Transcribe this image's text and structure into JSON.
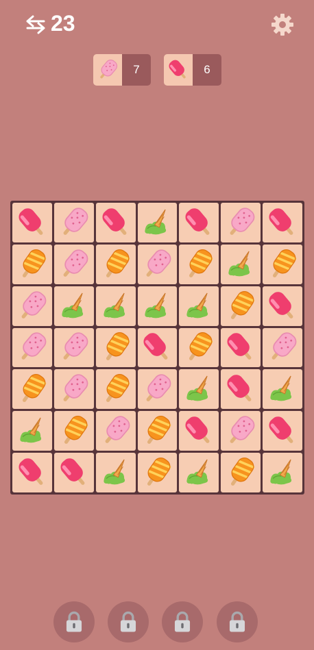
{
  "header": {
    "moves_left": "23",
    "moves_icon": "swap-arrows-icon",
    "settings_icon": "gear-icon"
  },
  "goals": [
    {
      "item": "pink-sprinkle-popsicle",
      "count": "7"
    },
    {
      "item": "red-popsicle",
      "count": "6"
    }
  ],
  "board": {
    "rows": 7,
    "cols": 7,
    "tiles": [
      [
        "red",
        "pink",
        "red",
        "cone",
        "red",
        "pink",
        "red"
      ],
      [
        "orange",
        "pink",
        "orange",
        "pink",
        "orange",
        "cone",
        "orange"
      ],
      [
        "pink",
        "cone",
        "cone",
        "cone",
        "cone",
        "orange",
        "red"
      ],
      [
        "pink",
        "pink",
        "orange",
        "red",
        "orange",
        "red",
        "pink"
      ],
      [
        "orange",
        "pink",
        "orange",
        "pink",
        "cone",
        "red",
        "cone"
      ],
      [
        "cone",
        "orange",
        "pink",
        "orange",
        "red",
        "pink",
        "red"
      ],
      [
        "red",
        "red",
        "cone",
        "orange",
        "cone",
        "orange",
        "cone"
      ]
    ]
  },
  "boosters": [
    {
      "state": "locked",
      "icon": "padlock-icon"
    },
    {
      "state": "locked",
      "icon": "padlock-icon"
    },
    {
      "state": "locked",
      "icon": "padlock-icon"
    },
    {
      "state": "locked",
      "icon": "padlock-icon"
    }
  ],
  "colors": {
    "background": "#c2807c",
    "tile": "#f7cdb3",
    "board_frame": "#57343a",
    "goal_count_bg": "#9a5a5c"
  }
}
